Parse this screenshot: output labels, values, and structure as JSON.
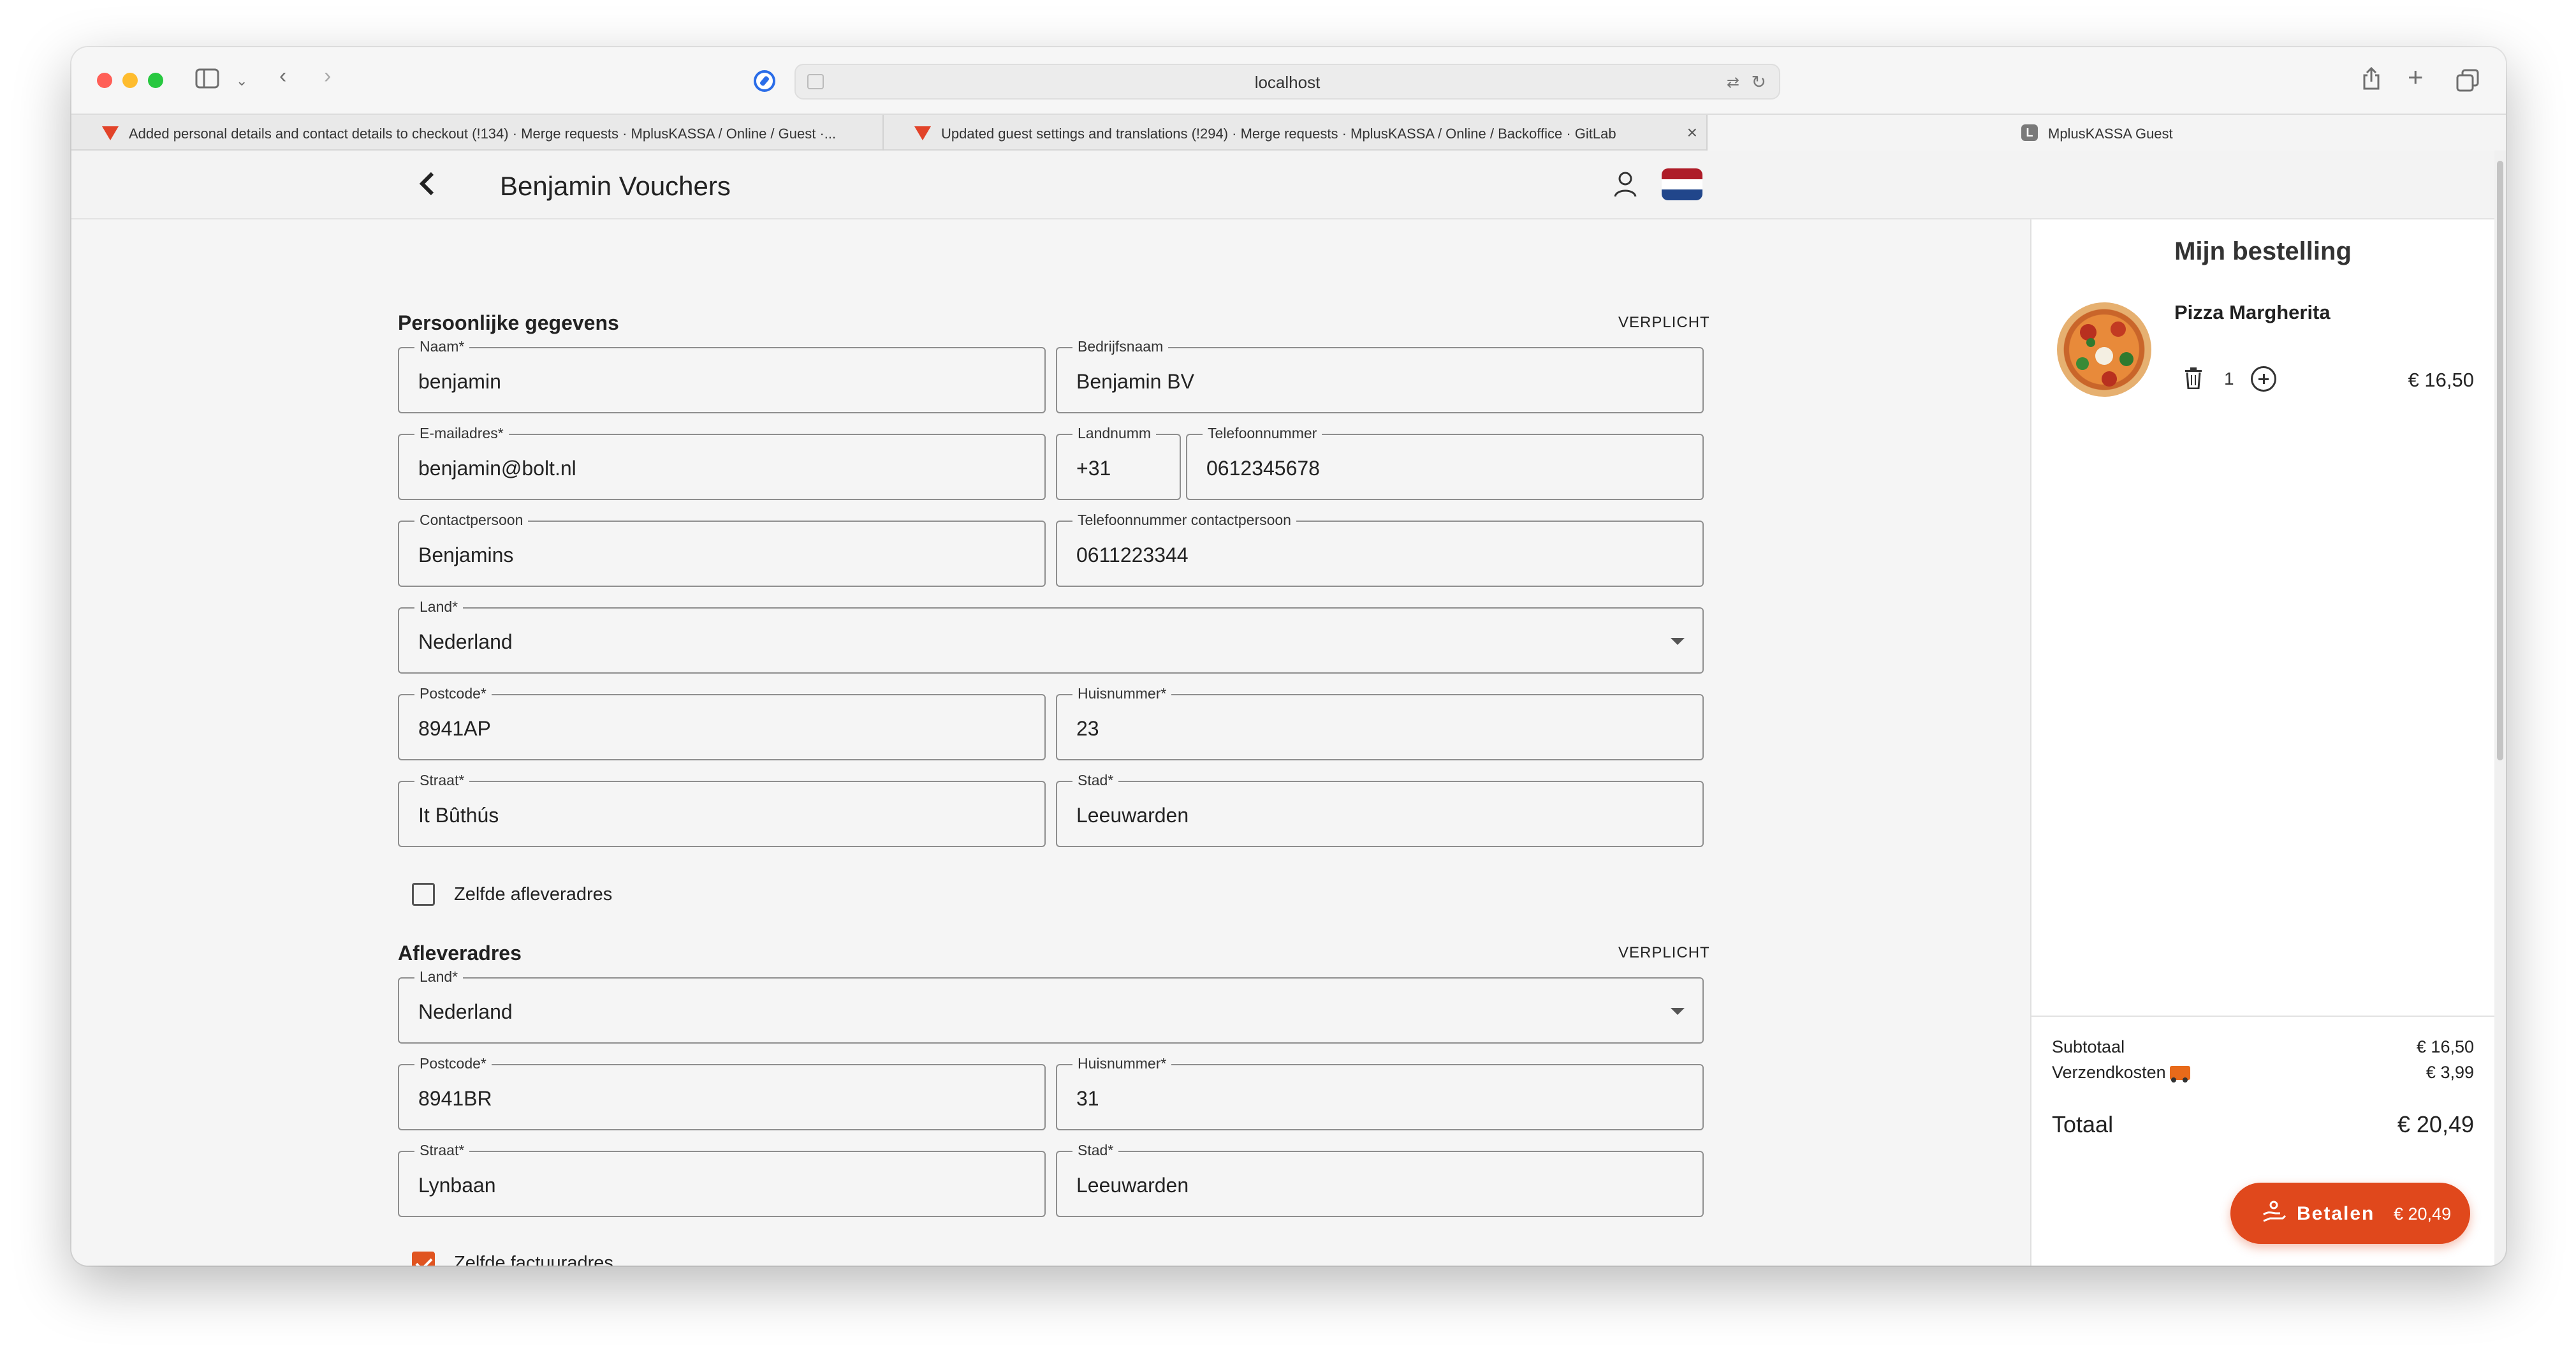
{
  "browser": {
    "url": "localhost",
    "tabs": [
      {
        "title": "Added personal details and contact details to checkout (!134) · Merge requests · MplusKASSA / Online / Guest ·..."
      },
      {
        "title": "Updated guest settings and translations (!294) · Merge requests · MplusKASSA / Online / Backoffice · GitLab"
      },
      {
        "title": "MplusKASSA Guest",
        "favicon_letter": "L"
      }
    ]
  },
  "header": {
    "title": "Benjamin Vouchers"
  },
  "personal": {
    "title": "Persoonlijke gegevens",
    "required": "VERPLICHT",
    "fields": [
      {
        "label": "Naam*",
        "value": "benjamin"
      },
      {
        "label": "Bedrijfsnaam",
        "value": "Benjamin BV"
      },
      {
        "label": "E-mailadres*",
        "value": "benjamin@bolt.nl"
      },
      {
        "label": "Landnumm",
        "value": "+31"
      },
      {
        "label": "Telefoonnummer",
        "value": "0612345678"
      },
      {
        "label": "Contactpersoon",
        "value": "Benjamins"
      },
      {
        "label": "Telefoonnummer contactpersoon",
        "value": "0611223344"
      },
      {
        "label": "Land*",
        "value": "Nederland"
      },
      {
        "label": "Postcode*",
        "value": "8941AP"
      },
      {
        "label": "Huisnummer*",
        "value": "23"
      },
      {
        "label": "Straat*",
        "value": "It Bûthús"
      },
      {
        "label": "Stad*",
        "value": "Leeuwarden"
      }
    ],
    "same_delivery_label": "Zelfde afleveradres",
    "same_delivery_checked": false
  },
  "delivery": {
    "title": "Afleveradres",
    "required": "VERPLICHT",
    "fields": [
      {
        "label": "Land*",
        "value": "Nederland"
      },
      {
        "label": "Postcode*",
        "value": "8941BR"
      },
      {
        "label": "Huisnummer*",
        "value": "31"
      },
      {
        "label": "Straat*",
        "value": "Lynbaan"
      },
      {
        "label": "Stad*",
        "value": "Leeuwarden"
      }
    ],
    "same_invoice_label": "Zelfde factuuradres",
    "same_invoice_checked": true,
    "terms_checked": true
  },
  "order": {
    "title": "Mijn bestelling",
    "item": {
      "name": "Pizza Margherita",
      "quantity": "1",
      "price": "€ 16,50"
    },
    "subtotal_label": "Subtotaal",
    "subtotal": "€ 16,50",
    "shipping_label": "Verzendkosten",
    "shipping": "€ 3,99",
    "total_label": "Totaal",
    "total": "€ 20,49",
    "pay_label": "Betalen",
    "pay_amount": "€ 20,49"
  },
  "colors": {
    "accent": "#e0481c",
    "checkbox": "#e05420"
  }
}
